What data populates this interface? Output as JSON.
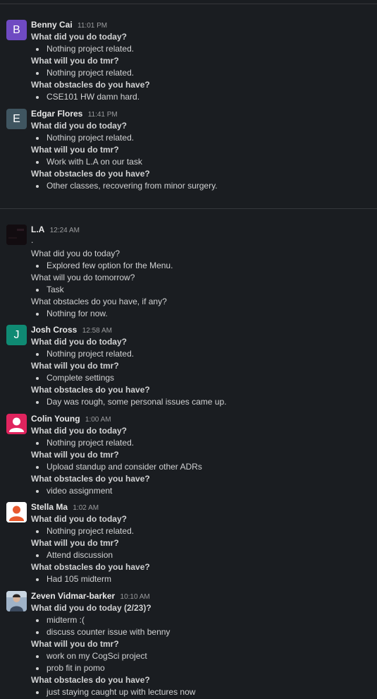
{
  "messages": [
    {
      "name": "Benny Cai",
      "time": "11:01 PM",
      "initial": "B",
      "avatar_color": "#6f4ac2",
      "lines": [
        {
          "type": "q",
          "text": "What did you do today?"
        },
        {
          "type": "b",
          "text": "Nothing project related."
        },
        {
          "type": "q",
          "text": "What will you do tmr?"
        },
        {
          "type": "b",
          "text": "Nothing project related."
        },
        {
          "type": "q",
          "text": "What obstacles do you have?"
        },
        {
          "type": "b",
          "text": "CSE101 HW damn hard."
        }
      ]
    },
    {
      "name": "Edgar Flores",
      "time": "11:41 PM",
      "initial": "E",
      "avatar_color": "#3f5560",
      "lines": [
        {
          "type": "q",
          "text": "What did you do today?"
        },
        {
          "type": "b",
          "text": "Nothing project related."
        },
        {
          "type": "q",
          "text": "What will you do tmr?"
        },
        {
          "type": "b",
          "text": "Work with L.A on our task"
        },
        {
          "type": "q",
          "text": "What obstacles do you have?"
        },
        {
          "type": "b",
          "text": "Other classes, recovering from minor surgery."
        }
      ]
    },
    {
      "name": "L.A",
      "time": "12:24 AM",
      "initial": "",
      "avatar_color": "#120c10",
      "first": ".",
      "lines": [
        {
          "type": "p",
          "text": "What did you do today?"
        },
        {
          "type": "b",
          "text": "Explored few option for the Menu."
        },
        {
          "type": "p",
          "text": "What will you do tomorrow?"
        },
        {
          "type": "b",
          "text": "Task"
        },
        {
          "type": "p",
          "text": "What obstacles do you have, if any?"
        },
        {
          "type": "b",
          "text": "Nothing for now."
        }
      ]
    },
    {
      "name": "Josh Cross",
      "time": "12:58 AM",
      "initial": "J",
      "avatar_color": "#0f8a73",
      "lines": [
        {
          "type": "q",
          "text": "What did you do today?"
        },
        {
          "type": "b",
          "text": "Nothing project related."
        },
        {
          "type": "q",
          "text": "What will you do tmr?"
        },
        {
          "type": "b",
          "text": "Complete settings"
        },
        {
          "type": "q",
          "text": "What obstacles do you have?"
        },
        {
          "type": "b",
          "text": "Day was rough, some personal issues came up."
        }
      ]
    },
    {
      "name": "Colin Young",
      "time": "1:00 AM",
      "initial": "",
      "avatar_color": "#e0245e",
      "lines": [
        {
          "type": "q",
          "text": "What did you do today?"
        },
        {
          "type": "b",
          "text": "Nothing project related."
        },
        {
          "type": "q",
          "text": "What will you do tmr?"
        },
        {
          "type": "b",
          "text": "Upload standup and consider other ADRs"
        },
        {
          "type": "q",
          "text": "What obstacles do you have?"
        },
        {
          "type": "b",
          "text": "video assignment"
        }
      ]
    },
    {
      "name": "Stella Ma",
      "time": "1:02 AM",
      "initial": "",
      "avatar_color": "#e8592e",
      "lines": [
        {
          "type": "q",
          "text": "What did you do today?"
        },
        {
          "type": "b",
          "text": "Nothing project related."
        },
        {
          "type": "q",
          "text": "What will you do tmr?"
        },
        {
          "type": "b",
          "text": "Attend discussion"
        },
        {
          "type": "q",
          "text": "What obstacles do you have?"
        },
        {
          "type": "b",
          "text": "Had 105 midterm"
        }
      ]
    },
    {
      "name": "Zeven Vidmar-barker",
      "time": "10:10 AM",
      "initial": "",
      "avatar_color": "#8aa0b8",
      "lines": [
        {
          "type": "q",
          "text": "What did you do today (2/23)?"
        },
        {
          "type": "b",
          "text": "midterm :("
        },
        {
          "type": "b",
          "text": "discuss counter issue with benny"
        },
        {
          "type": "q",
          "text": "What will you do tmr?"
        },
        {
          "type": "b",
          "text": "work on my CogSci project"
        },
        {
          "type": "b",
          "text": "prob fit in pomo"
        },
        {
          "type": "q",
          "text": "What obstacles do you have?"
        },
        {
          "type": "b",
          "text": "just staying caught up with lectures now"
        }
      ]
    }
  ]
}
